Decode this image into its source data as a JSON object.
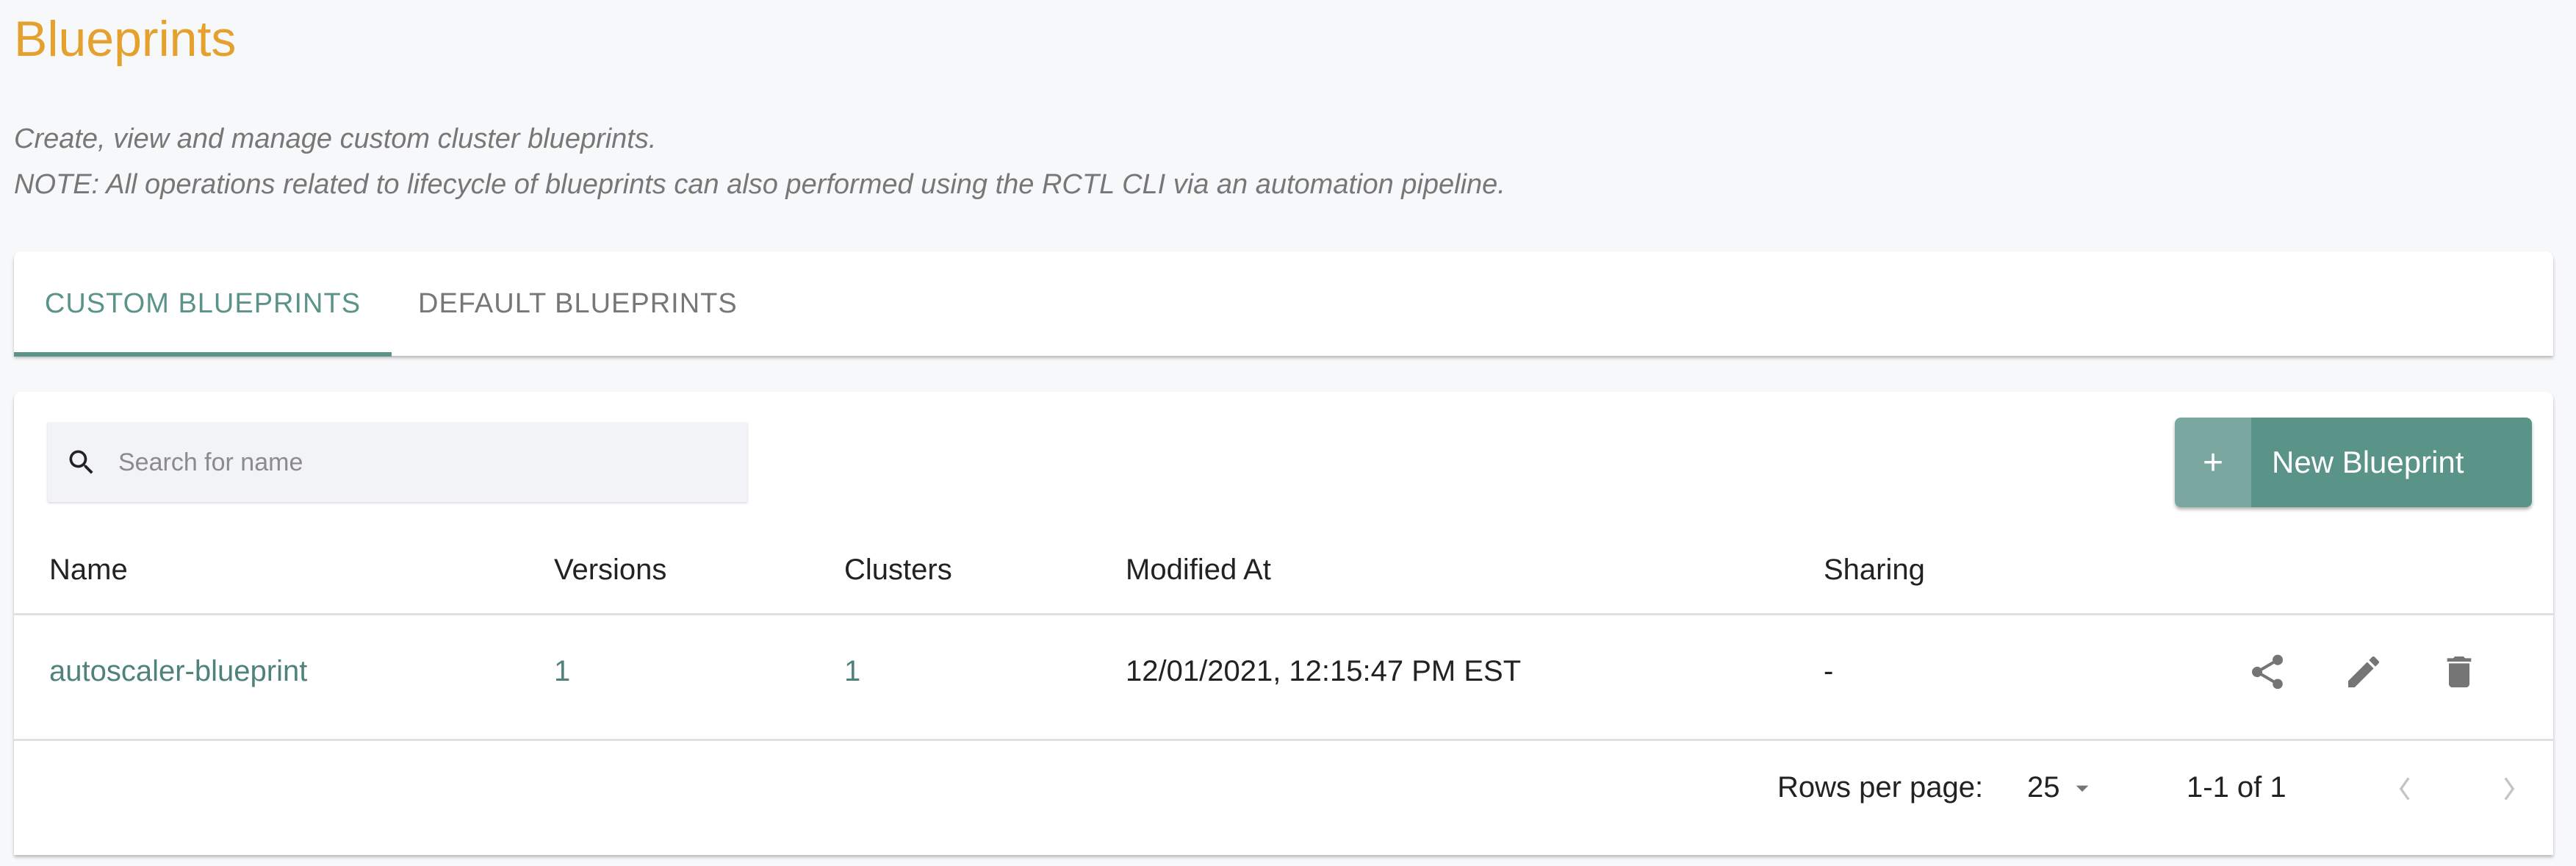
{
  "page": {
    "title": "Blueprints",
    "description_line1": "Create, view and manage custom cluster blueprints.",
    "description_line2": "NOTE: All operations related to lifecycle of blueprints can also performed using the RCTL CLI via an automation pipeline."
  },
  "tabs": [
    {
      "label": "CUSTOM BLUEPRINTS",
      "active": true
    },
    {
      "label": "DEFAULT BLUEPRINTS",
      "active": false
    }
  ],
  "search": {
    "placeholder": "Search for name",
    "value": ""
  },
  "toolbar": {
    "new_button_icon": "+",
    "new_button_label": "New Blueprint"
  },
  "table": {
    "columns": [
      "Name",
      "Versions",
      "Clusters",
      "Modified At",
      "Sharing"
    ],
    "rows": [
      {
        "name": "autoscaler-blueprint",
        "versions": "1",
        "clusters": "1",
        "modified_at": "12/01/2021, 12:15:47 PM EST",
        "sharing": "-",
        "actions": [
          "share-icon",
          "edit-icon",
          "delete-icon"
        ]
      }
    ]
  },
  "pagination": {
    "rows_per_page_label": "Rows per page:",
    "rows_per_page": "25",
    "range": "1-1 of 1"
  },
  "colors": {
    "title": "#e5a12e",
    "accent": "#5a9488",
    "accent_light": "#7aa8a0"
  }
}
